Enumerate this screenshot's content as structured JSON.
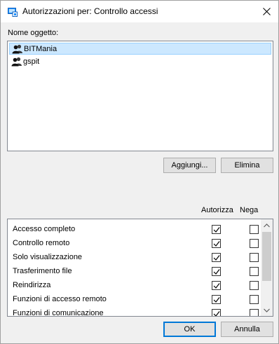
{
  "window": {
    "title": "Autorizzazioni per: Controllo accessi"
  },
  "objects": {
    "label": "Nome oggetto:",
    "items": [
      {
        "name": "BITMania",
        "icon": "user-group-icon",
        "selected": true
      },
      {
        "name": "gspit",
        "icon": "user-group-icon",
        "selected": false
      }
    ]
  },
  "buttons": {
    "add": "Aggiungi...",
    "remove": "Elimina",
    "ok": "OK",
    "cancel": "Annulla"
  },
  "permissions": {
    "allow_header": "Autorizza",
    "deny_header": "Nega",
    "rows": [
      {
        "label": "Accesso completo",
        "allow": true,
        "deny": false
      },
      {
        "label": "Controllo remoto",
        "allow": true,
        "deny": false
      },
      {
        "label": "Solo visualizzazione",
        "allow": true,
        "deny": false
      },
      {
        "label": "Trasferimento file",
        "allow": true,
        "deny": false
      },
      {
        "label": "Reindirizza",
        "allow": true,
        "deny": false
      },
      {
        "label": "Funzioni di accesso remoto",
        "allow": true,
        "deny": false
      },
      {
        "label": "Funzioni di comunicazione",
        "allow": true,
        "deny": false
      }
    ]
  },
  "colors": {
    "selection": "#cce8ff",
    "accent": "#0078d7"
  }
}
